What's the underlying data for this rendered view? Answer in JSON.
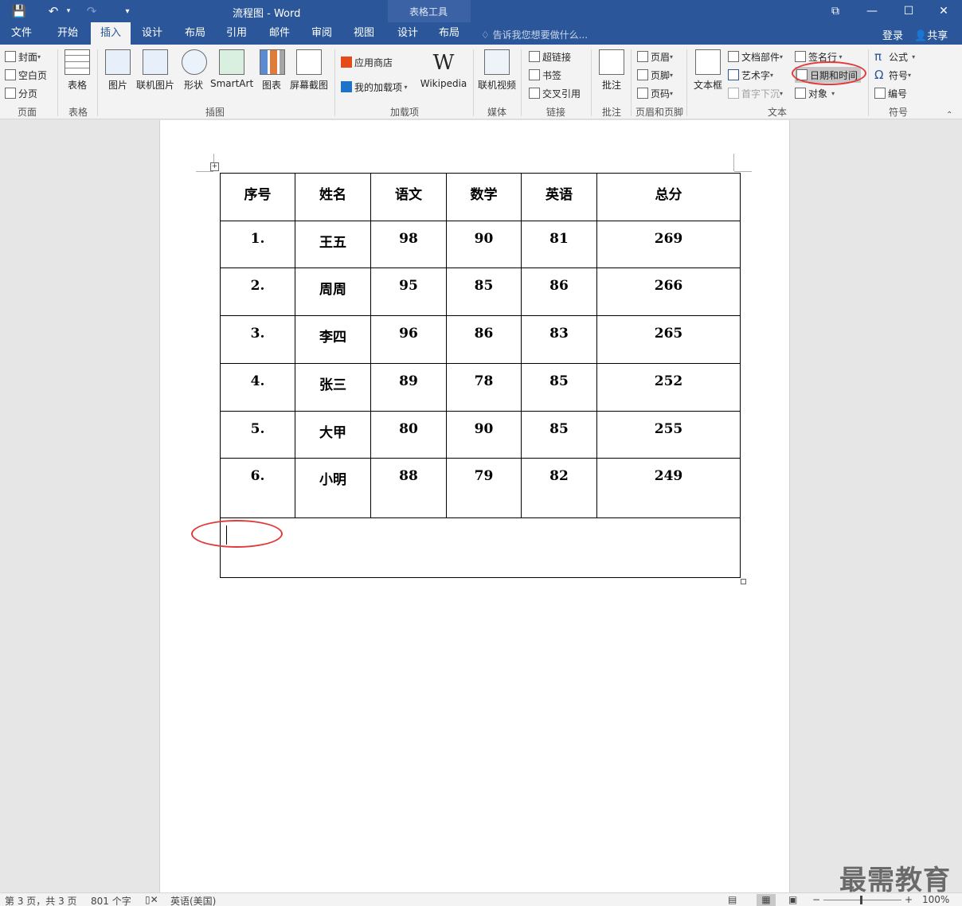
{
  "window": {
    "title": "流程图 - Word",
    "context_group": "表格工具",
    "restore_ribbon": "⧉",
    "minimize": "—",
    "maximize": "☐",
    "close": "✕"
  },
  "quick_access": {
    "save_icon": "💾",
    "undo_icon": "↶",
    "undo_caret": "▾",
    "redo_icon": "↷",
    "customize_icon": "▾"
  },
  "tabs": [
    "文件",
    "开始",
    "插入",
    "设计",
    "布局",
    "引用",
    "邮件",
    "审阅",
    "视图",
    "设计",
    "布局"
  ],
  "tell_me": "告诉我您想要做什么...",
  "signin": "登录",
  "share": "共享",
  "ribbon": {
    "pages": {
      "label": "页面",
      "cover": "封面",
      "blank": "空白页",
      "break": "分页"
    },
    "tables": {
      "label": "表格",
      "table": "表格"
    },
    "illustrations": {
      "label": "插图",
      "picture": "图片",
      "online_picture": "联机图片",
      "shapes": "形状",
      "smartart": "SmartArt",
      "chart": "图表",
      "screenshot": "屏幕截图"
    },
    "addins": {
      "label": "加载项",
      "store": "应用商店",
      "my_addins": "我的加载项",
      "wikipedia": "Wikipedia",
      "wiki_glyph": "W"
    },
    "media": {
      "label": "媒体",
      "online_video": "联机视频"
    },
    "links": {
      "label": "链接",
      "hyperlink": "超链接",
      "bookmark": "书签",
      "crossref": "交叉引用"
    },
    "comments": {
      "label": "批注",
      "comment": "批注"
    },
    "header_footer": {
      "label": "页眉和页脚",
      "header": "页眉",
      "footer": "页脚",
      "page_number": "页码"
    },
    "text": {
      "label": "文本",
      "textbox": "文本框",
      "quickparts": "文档部件",
      "wordart": "艺术字",
      "dropcap": "首字下沉",
      "signature": "签名行",
      "datetime": "日期和时间",
      "object": "对象"
    },
    "symbols": {
      "label": "符号",
      "equation": "公式",
      "symbol": "符号",
      "number": "编号",
      "pi": "π",
      "omega": "Ω"
    }
  },
  "table": {
    "headers": [
      "序号",
      "姓名",
      "语文",
      "数学",
      "英语",
      "总分"
    ],
    "rows": [
      [
        "1.",
        "王五",
        "98",
        "90",
        "81",
        "269"
      ],
      [
        "2.",
        "周周",
        "95",
        "85",
        "86",
        "266"
      ],
      [
        "3.",
        "李四",
        "96",
        "86",
        "83",
        "265"
      ],
      [
        "4.",
        "张三",
        "89",
        "78",
        "85",
        "252"
      ],
      [
        "5.",
        "大甲",
        "80",
        "90",
        "85",
        "255"
      ],
      [
        "6.",
        "小明",
        "88",
        "79",
        "82",
        "249"
      ]
    ]
  },
  "status": {
    "page": "第 3 页，共 3 页",
    "words": "801 个字",
    "language": "英语(美国)",
    "zoom": "100%",
    "zoom_minus": "−",
    "zoom_plus": "+"
  },
  "watermark": "最需教育",
  "colors": {
    "ribbon_blue": "#2b579a",
    "annotation_red": "#e23a3a"
  }
}
